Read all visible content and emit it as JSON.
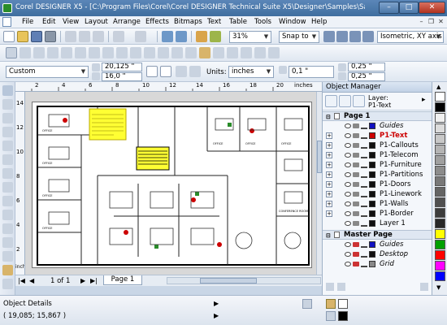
{
  "window": {
    "title": "Corel DESIGNER X5 - [C:\\Program Files\\Corel\\Corel DESIGNER Technical Suite X5\\Designer\\Samples\\Sample2.des]"
  },
  "menu": [
    "File",
    "Edit",
    "View",
    "Layout",
    "Arrange",
    "Effects",
    "Bitmaps",
    "Text",
    "Table",
    "Tools",
    "Window",
    "Help"
  ],
  "toolbar1": {
    "zoom": "31%",
    "snap": "Snap to",
    "projection": "Isometric, XY axis"
  },
  "toolbar2": {},
  "toolbar3": {
    "preset": "Custom",
    "x": "20,125 \"",
    "y": "16,0 \"",
    "units_label": "Units:",
    "units": "inches",
    "nudge": "0,1 \"",
    "dup_x": "0,25 \"",
    "dup_y": "0,25 \"",
    "rotation": "0,0 \""
  },
  "rulers": {
    "h_ticks": [
      "2",
      "4",
      "6",
      "8",
      "10",
      "12",
      "14",
      "16",
      "18",
      "20"
    ],
    "h_unit": "inches",
    "v_ticks": [
      "14",
      "12",
      "10",
      "8",
      "6",
      "4",
      "2"
    ],
    "v_unit": "inches"
  },
  "pagenav": {
    "position": "1 of 1",
    "tab": "Page 1"
  },
  "plan": {
    "room_label": "OFFICE",
    "conf_label": "CONFERENCE ROOM"
  },
  "docker": {
    "title": "Object Manager",
    "layer_label": "Layer:",
    "layer_value": "P1-Text",
    "page1": "Page 1",
    "layers": [
      "Guides",
      "P1-Text",
      "P1-Callouts",
      "P1-Telecom",
      "P1-Furniture",
      "P1-Partitions",
      "P1-Doors",
      "P1-Linework",
      "P1-Walls",
      "P1-Border",
      "Layer 1"
    ],
    "master": "Master Page",
    "master_layers": [
      "Guides",
      "Desktop",
      "Grid"
    ],
    "active_color": "#cc0000",
    "layer_colors": [
      "#1010c0",
      "#cc0000",
      "#101010",
      "#101010",
      "#101010",
      "#101010",
      "#101010",
      "#101010",
      "#101010",
      "#101010",
      "#101010"
    ]
  },
  "status": {
    "details": "Object Details",
    "coords": "( 19,085; 15,867 )"
  },
  "palette": [
    "#ffffff",
    "#000000",
    "#f0f0f0",
    "#dcdcdc",
    "#c8c8c8",
    "#b4b4b4",
    "#a0a0a0",
    "#8c8c8c",
    "#787878",
    "#646464",
    "#505050",
    "#3c3c3c",
    "#282828",
    "#ffff00",
    "#00a000",
    "#ff0000",
    "#ff00ff",
    "#0000ff",
    "#00ffff",
    "#ff8000"
  ]
}
